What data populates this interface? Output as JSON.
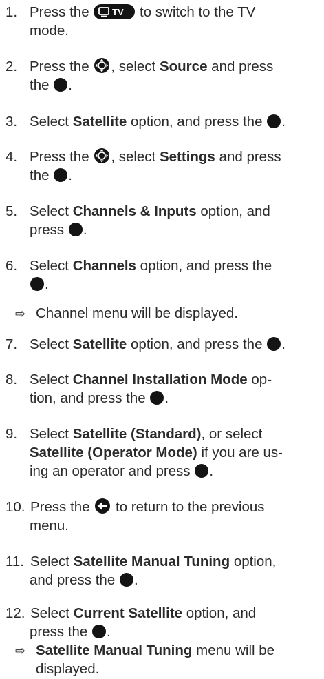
{
  "steps": [
    {
      "num": "1.",
      "l1a": "Press the",
      "l1b": "to switch to the TV",
      "l2": "mode."
    },
    {
      "num": "2.",
      "l1a": "Press the",
      "l1b": ", select",
      "l1c": "Source",
      "l1d": "and press",
      "l2": "the",
      "l2b": "."
    },
    {
      "num": "3.",
      "a": "Select",
      "b": "Satellite",
      "c": "option, and press the",
      "d": "."
    },
    {
      "num": "4.",
      "l1a": "Press the",
      "l1b": ", select",
      "l1c": "Settings",
      "l1d": "and press",
      "l2": "the",
      "l2b": "."
    },
    {
      "num": "5.",
      "a": "Select",
      "b": "Channels & Inputs",
      "c": "option, and",
      "l2": "press",
      "l2b": "."
    },
    {
      "num": "6.",
      "a": "Select",
      "b": "Channels",
      "c": "option, and press the",
      "l2b": "."
    },
    {
      "arrow": "⇨",
      "text": "Channel menu will be displayed."
    },
    {
      "num": "7.",
      "a": "Select",
      "b": "Satellite",
      "c": "option, and press the",
      "d": "."
    },
    {
      "num": "8.",
      "a": "Select",
      "b": "Channel Installation Mode",
      "c": "op-",
      "l2": "tion, and press the",
      "l2b": "."
    },
    {
      "num": "9.",
      "a": "Select",
      "b": "Satellite (Standard)",
      "c": ", or select",
      "l2bold": "Satellite (Operator Mode)",
      "l2": "if you are us-",
      "l3": "ing an operator and press",
      "l3b": "."
    },
    {
      "num": "10.",
      "l1a": "Press the",
      "l1b": "to return to the previous",
      "l2": "menu."
    },
    {
      "num": "11.",
      "l1a": "Select",
      "l1b": "Satellite Manual Tuning",
      "l1c": "option,",
      "l2": "and press the",
      "l2b": "."
    },
    {
      "num": "12.",
      "l1a": "Select",
      "l1b": "Current Satellite",
      "l1c": "option, and",
      "l2": "press the",
      "l2b": "."
    },
    {
      "arrow": "⇨",
      "bold": "Satellite Manual Tuning",
      "text": "menu will be",
      "l2": "displayed."
    }
  ],
  "icons": {
    "tv_button_label": "TV",
    "tv": "tv-button-icon",
    "nav": "navigation-pad-icon",
    "ok": "ok-button-icon",
    "back": "back-arrow-icon"
  },
  "colors": {
    "text": "#2b2b2b",
    "icon": "#141414"
  }
}
